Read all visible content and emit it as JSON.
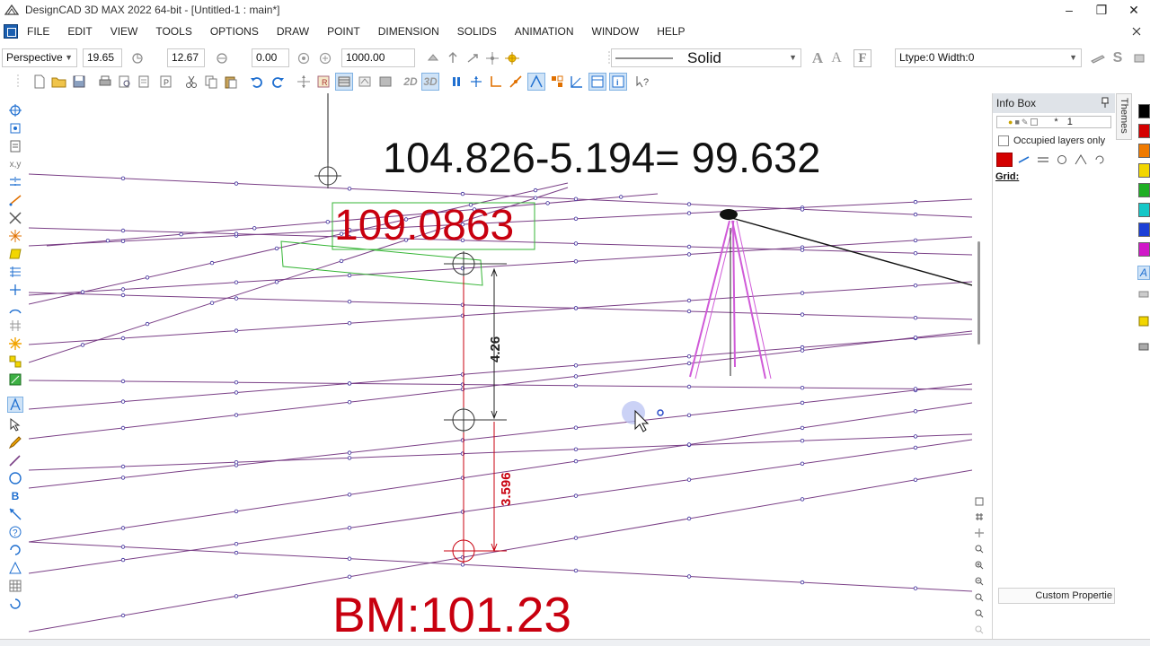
{
  "window": {
    "title": "DesignCAD 3D MAX 2022 64-bit - [Untitled-1 : main*]",
    "controls": {
      "minimize": "–",
      "restore": "❐",
      "close": "✕"
    }
  },
  "menu": {
    "items": [
      "FILE",
      "EDIT",
      "VIEW",
      "TOOLS",
      "OPTIONS",
      "DRAW",
      "POINT",
      "DIMENSION",
      "SOLIDS",
      "ANIMATION",
      "WINDOW",
      "HELP"
    ]
  },
  "toolbar": {
    "view_mode": "Perspective",
    "angle_a": "19.65",
    "angle_b": "12.67",
    "angle_c": "0.00",
    "distance": "1000.00",
    "line_style": "Solid",
    "ltype_width": "Ltype:0  Width:0",
    "btn_2d": "2D",
    "btn_3d": "3D"
  },
  "viewport": {
    "annotation_formula": "104.826-5.194= 99.632",
    "annotation_value": "109.0863",
    "dim_upper": "4.26",
    "dim_lower": "3.596",
    "benchmark_label": "BM:101.23",
    "colors": {
      "grid": "#7a3f86",
      "dimension_red": "#c8000f",
      "highlight_green": "#35b535",
      "tripod": "#d05ad8"
    }
  },
  "info_box": {
    "title": "Info Box",
    "layer_value": "1",
    "layer_star": "*",
    "occupied_layers_label": "Occupied layers only",
    "grid_label": "Grid:",
    "custom_properties_label": "Custom Propertie"
  },
  "side_tabs": {
    "themes": "Themes"
  },
  "palette": {
    "colors": [
      "#000000",
      "#d40000",
      "#ef7a00",
      "#f2d600",
      "#1fae24",
      "#15c7c7",
      "#1b3fd6",
      "#d018c8"
    ]
  }
}
